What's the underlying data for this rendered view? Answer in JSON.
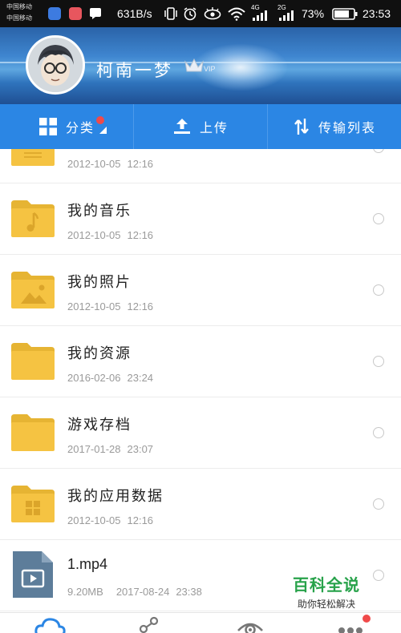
{
  "status_bar": {
    "carrier_line1": "中国移动",
    "carrier_line2": "中国移动",
    "net_speed": "631B/s",
    "sim1_type": "4G",
    "sim2_type": "2G",
    "battery": "73%",
    "time": "23:53"
  },
  "header": {
    "username": "柯南一梦",
    "vip_label": "VIP"
  },
  "tabs": [
    {
      "label": "分类"
    },
    {
      "label": "上传"
    },
    {
      "label": "传输列表"
    }
  ],
  "files": [
    {
      "name": "",
      "date": "2012-10-05",
      "time": "12:16",
      "icon": "folder-icon"
    },
    {
      "name": "我的音乐",
      "date": "2012-10-05",
      "time": "12:16",
      "icon": "music-folder-icon"
    },
    {
      "name": "我的照片",
      "date": "2012-10-05",
      "time": "12:16",
      "icon": "photo-folder-icon"
    },
    {
      "name": "我的资源",
      "date": "2016-02-06",
      "time": "23:24",
      "icon": "folder-icon"
    },
    {
      "name": "游戏存档",
      "date": "2017-01-28",
      "time": "23:07",
      "icon": "folder-icon"
    },
    {
      "name": "我的应用数据",
      "date": "2012-10-05",
      "time": "12:16",
      "icon": "app-folder-icon"
    },
    {
      "name": "1.mp4",
      "size": "9.20MB",
      "date": "2017-08-24",
      "time": "23:38",
      "icon": "video-file-icon"
    }
  ],
  "watermark": {
    "title": "百科全说",
    "subtitle": "助你轻松解决"
  },
  "bottom_nav": [
    {
      "icon": "cloud-icon"
    },
    {
      "icon": "share-icon"
    },
    {
      "icon": "eye-icon"
    },
    {
      "icon": "more-icon"
    }
  ],
  "colors": {
    "accent": "#2b86e4",
    "folder": "#f5c342",
    "badge": "#f04a4a",
    "brand_green": "#27a24a"
  }
}
